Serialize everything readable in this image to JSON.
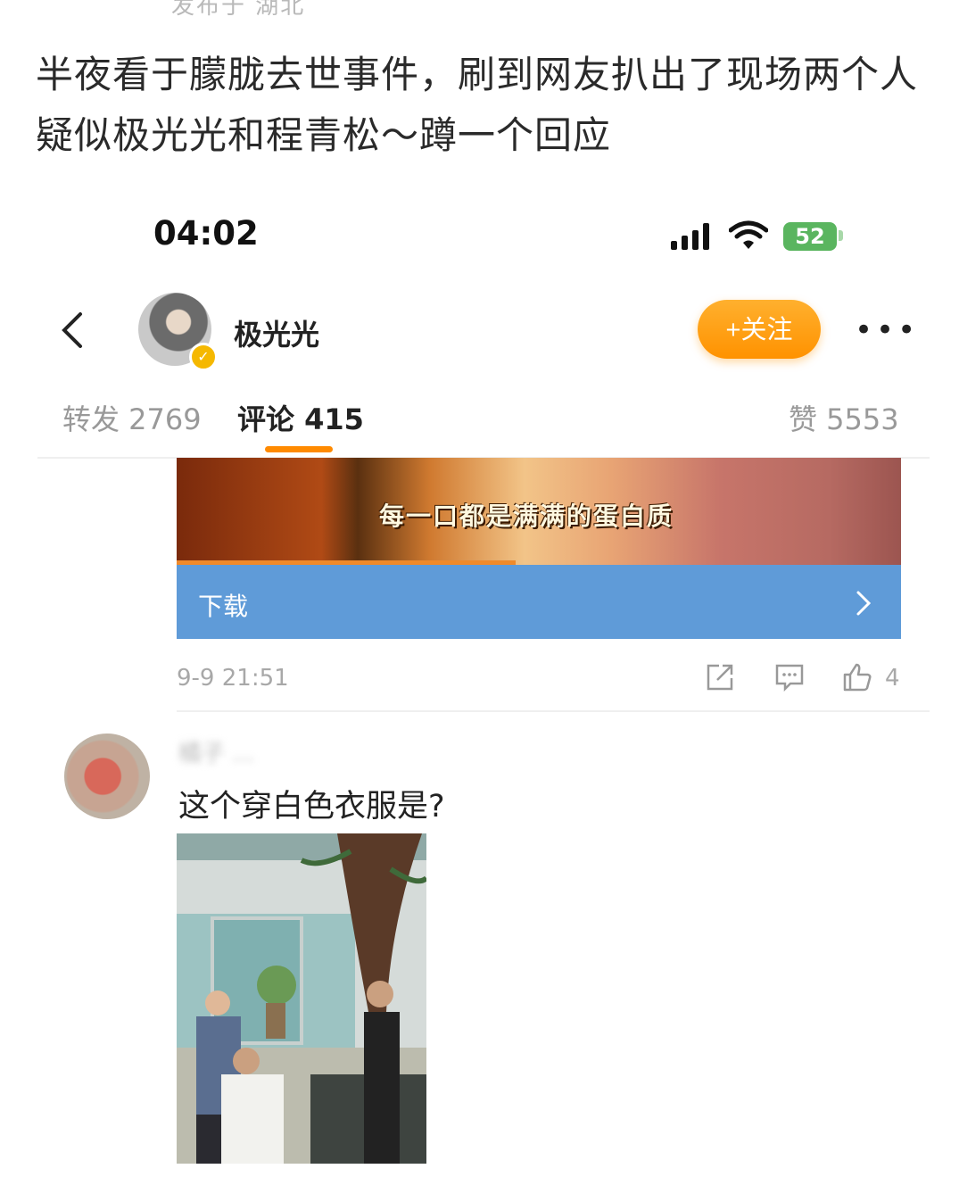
{
  "post": {
    "location": "发布于 湖北",
    "headline": "半夜看于朦胧去世事件，刷到网友扒出了现场两个人疑似极光光和程青松～蹲一个回应"
  },
  "status_bar": {
    "time": "04:02",
    "battery": "52"
  },
  "profile": {
    "username": "极光光",
    "follow_label": "+关注",
    "more_label": "•••"
  },
  "tabs": [
    {
      "label": "转发 2769",
      "active": false
    },
    {
      "label": "评论 415",
      "active": true
    },
    {
      "label": "赞 5553",
      "active": false
    }
  ],
  "ad": {
    "caption": "每一口都是满满的蛋白质",
    "download_label": "下载"
  },
  "comment_meta": {
    "timestamp": "9-9 21:51",
    "like_count": "4"
  },
  "comment": {
    "author_blurred": "橘子 ...",
    "text": "这个穿白色衣服是?"
  },
  "colors": {
    "accent": "#ff8a00",
    "download_bar": "#5f9bd8",
    "battery": "#5ab55f"
  },
  "icons": [
    "back-icon",
    "verified-icon",
    "more-icon",
    "share-icon",
    "comment-icon",
    "like-icon",
    "chevron-right-icon",
    "signal-icon",
    "wifi-icon",
    "battery-icon"
  ]
}
